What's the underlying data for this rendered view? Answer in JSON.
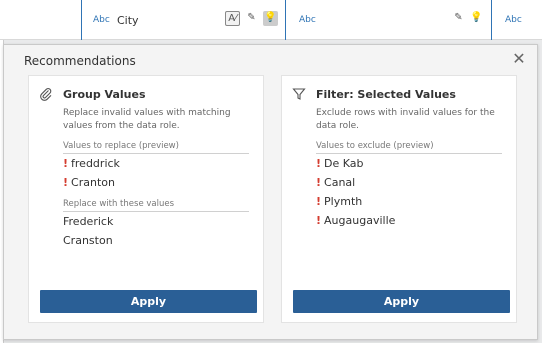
{
  "columns": [
    {
      "type": "",
      "name": ""
    },
    {
      "type": "Abc",
      "name": "City"
    },
    {
      "type": "Abc",
      "name": ""
    },
    {
      "type": "Abc",
      "name": ""
    }
  ],
  "dialog": {
    "title": "Recommendations",
    "close_icon": "close-icon",
    "cards": [
      {
        "icon": "paperclip-icon",
        "title": "Group Values",
        "description": "Replace invalid values with matching values from the data role.",
        "section1_label": "Values to replace (preview)",
        "invalid_values": [
          "freddrick",
          "Cranton"
        ],
        "section2_label": "Replace with these values",
        "replacement_values": [
          "Frederick",
          "Cranston"
        ],
        "button_label": "Apply"
      },
      {
        "icon": "filter-icon",
        "title": "Filter: Selected Values",
        "description": "Exclude rows with invalid values for the data role.",
        "section1_label": "Values to exclude (preview)",
        "invalid_values": [
          "De Kab",
          "Canal",
          "Plymth",
          "Augaugaville"
        ],
        "button_label": "Apply"
      }
    ]
  },
  "colors": {
    "accent": "#2a5f96",
    "column_border": "#2f74b5",
    "invalid_marker": "#d43c2f"
  }
}
